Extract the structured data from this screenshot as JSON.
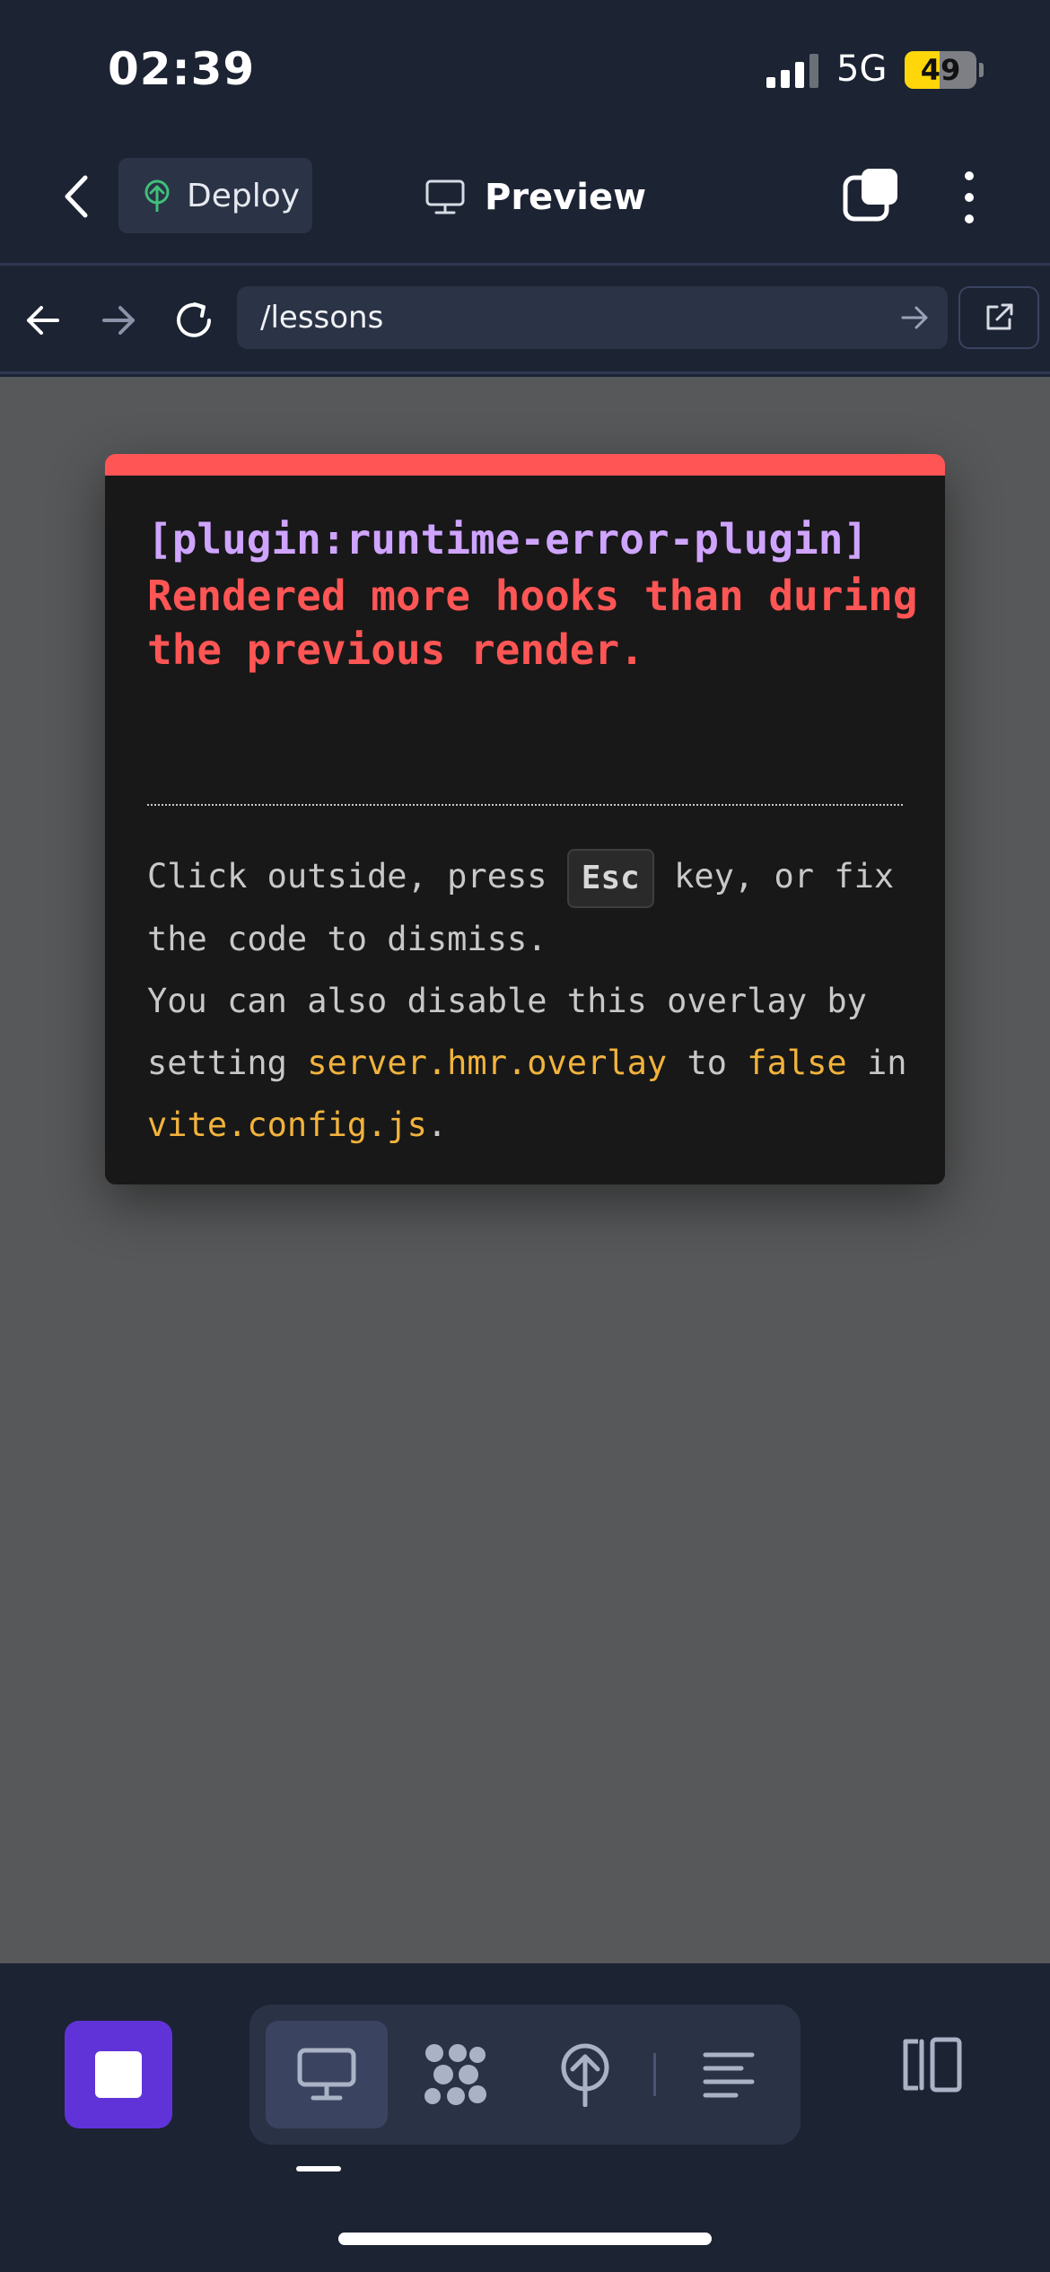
{
  "status_bar": {
    "time": "02:39",
    "network": "5G",
    "battery_level": "49",
    "battery_fraction": 0.49,
    "battery_color": "#ffd60a"
  },
  "header": {
    "deploy_label": "Deploy",
    "title": "Preview",
    "icons": {
      "back": "chevron-left-icon",
      "deploy": "deploy-tree-icon",
      "title": "monitor-icon",
      "tabs": "tabs-icon",
      "more": "more-vertical-icon"
    }
  },
  "browser": {
    "url": "/lessons",
    "icons": {
      "back": "arrow-left-icon",
      "forward": "arrow-right-icon",
      "reload": "reload-icon",
      "go": "arrow-right-icon",
      "external": "external-link-icon"
    }
  },
  "error_overlay": {
    "plugin": "[plugin:runtime-error-plugin]",
    "message": "Rendered more hooks than during the previous render.",
    "tip_part1": "Click outside, press ",
    "tip_key": "Esc",
    "tip_part2": " key, or fix the code to dismiss.",
    "tip_line2": "You can also disable this overlay by setting ",
    "tip_code1": "server.hmr.overlay",
    "tip_mid": " to ",
    "tip_code2": "false",
    "tip_mid2": " in ",
    "tip_code3": "vite.config.js",
    "tip_end": ".",
    "colors": {
      "accent": "#ff5555",
      "plugin": "#cfa4ff",
      "code": "#f2b33c"
    }
  },
  "bottom_bar": {
    "stop_color": "#6033d9",
    "tools": [
      "monitor-icon",
      "packages-icon",
      "deploy-tree-icon",
      "logs-icon"
    ],
    "active_tool": "monitor-icon",
    "layout_icon": "split-layout-icon"
  }
}
